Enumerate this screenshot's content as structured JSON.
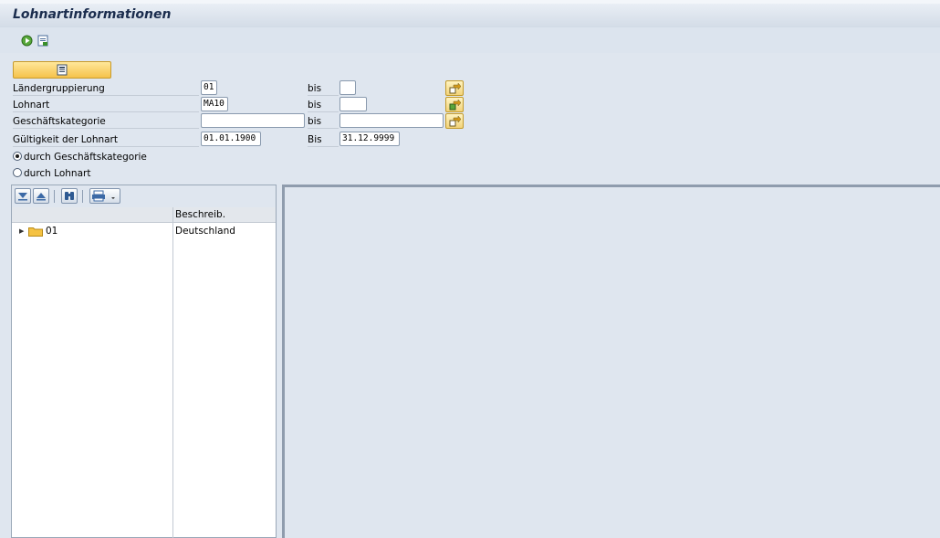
{
  "window": {
    "title": "Lohnartinformationen"
  },
  "toolbar": {
    "icons": [
      "execute-icon",
      "variant-icon"
    ]
  },
  "selection": {
    "execute_icon": "execute-button-icon",
    "rows": [
      {
        "label": "Ländergruppierung",
        "from": "01",
        "to_label": "bis",
        "to": ""
      },
      {
        "label": "Lohnart",
        "from": "MA10",
        "to_label": "bis",
        "to": ""
      },
      {
        "label": "Geschäftskategorie",
        "from": "",
        "to_label": "bis",
        "to": ""
      },
      {
        "label": "Gültigkeit der Lohnart",
        "from": "01.01.1900",
        "to_label": "Bis",
        "to": "31.12.9999"
      }
    ],
    "radios": [
      {
        "label": "durch Geschäftskategorie",
        "selected": true
      },
      {
        "label": "durch Lohnart",
        "selected": false
      }
    ]
  },
  "tree": {
    "toolbar_icons": [
      "expand-icon",
      "collapse-icon",
      "find-icon",
      "print-icon"
    ],
    "columns": [
      "",
      "Beschreib."
    ],
    "rows": [
      {
        "node": "01",
        "description": "Deutschland"
      }
    ]
  },
  "colors": {
    "accent": "#f5c24b",
    "background": "#dfe6ef",
    "title": "#1b2d4e"
  }
}
